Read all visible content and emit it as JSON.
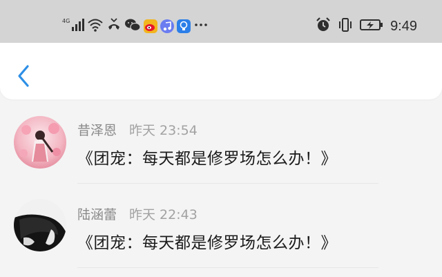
{
  "status_bar": {
    "signal_label": "4G",
    "time": "9:49",
    "icons": [
      "signal-icon",
      "wifi-icon",
      "missed-call-icon",
      "wechat-icon",
      "weibo-icon",
      "music-app-icon",
      "bulb-app-icon",
      "more-dots-icon",
      "alarm-icon",
      "vibrate-icon",
      "battery-charging-icon"
    ]
  },
  "nav": {
    "back_icon": "chevron-left-icon",
    "accent_color": "#2d8fe6"
  },
  "comments": [
    {
      "user": "昔泽恩",
      "time": "昨天 23:54",
      "message": "《团宠：每天都是修罗场怎么办！》"
    },
    {
      "user": "陆涵蕾",
      "time": "昨天 22:43",
      "message": "《团宠：每天都是修罗场怎么办！》"
    }
  ]
}
